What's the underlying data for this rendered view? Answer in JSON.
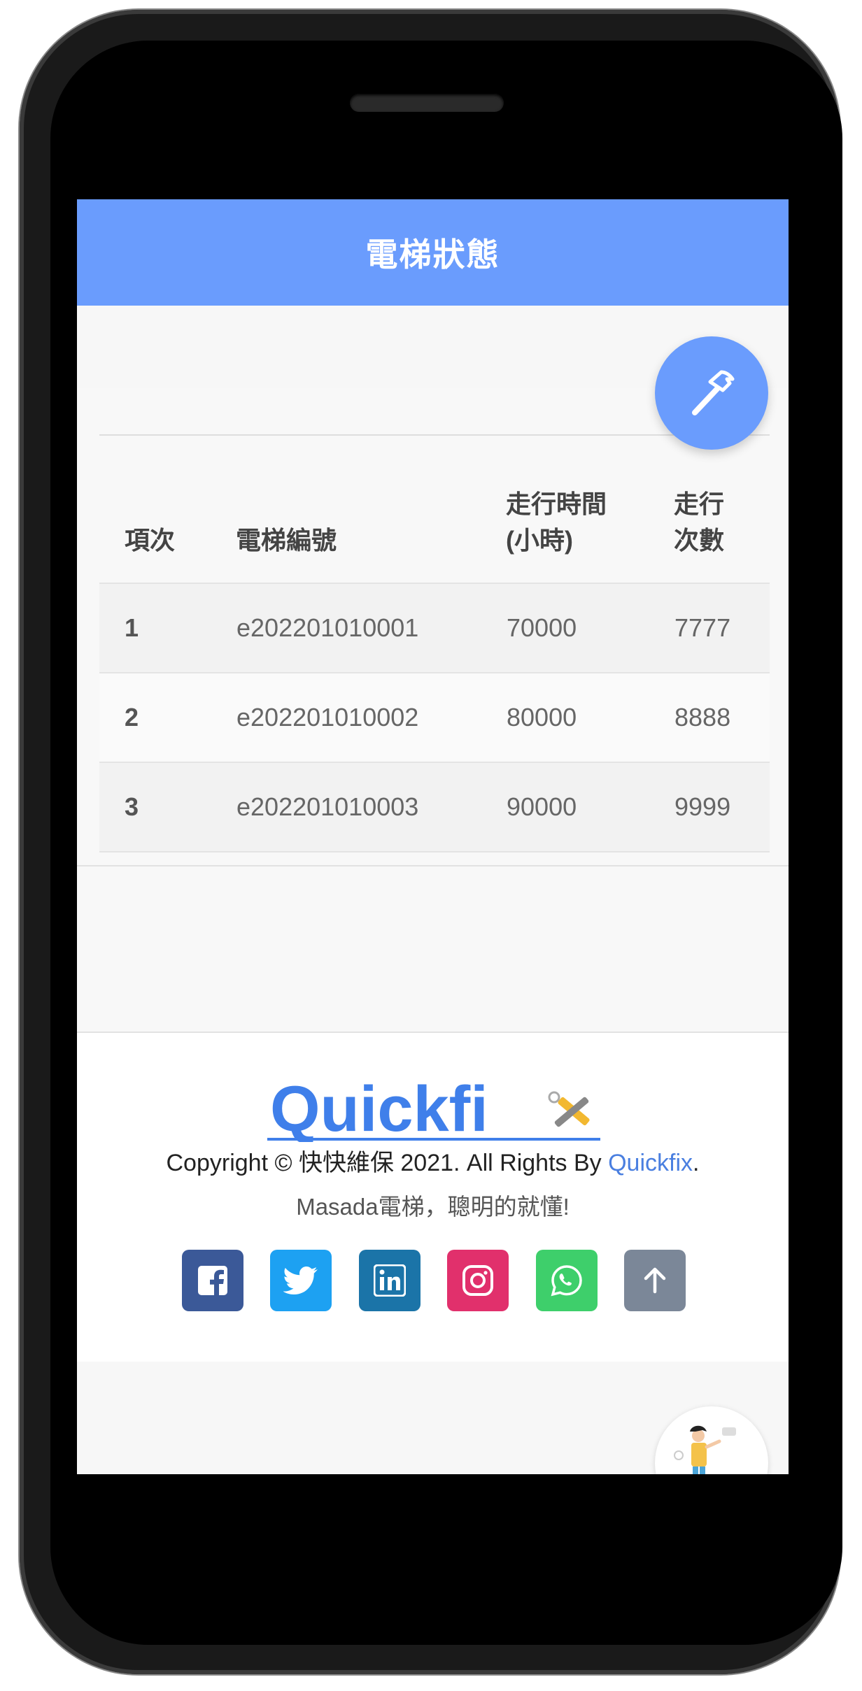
{
  "header": {
    "title": "電梯狀態"
  },
  "table": {
    "headers": [
      {
        "line1": "",
        "line2": "項次"
      },
      {
        "line1": "",
        "line2": "電梯編號"
      },
      {
        "line1": "走行時間",
        "line2": "(小時)"
      },
      {
        "line1": "走行",
        "line2": "次數"
      }
    ],
    "rows": [
      {
        "index": "1",
        "elevator_id": "e202201010001",
        "run_hours": "70000",
        "run_count": "7777"
      },
      {
        "index": "2",
        "elevator_id": "e202201010002",
        "run_hours": "80000",
        "run_count": "8888"
      },
      {
        "index": "3",
        "elevator_id": "e202201010003",
        "run_hours": "90000",
        "run_count": "9999"
      }
    ]
  },
  "footer": {
    "logo_text": "Quickfi",
    "copyright_prefix": "Copyright © 快快維保 2021. All Rights By ",
    "copyright_brand": "Quickfix",
    "copyright_suffix": ".",
    "tagline": "Masada電梯，聰明的就懂!",
    "socials": [
      {
        "icon": "facebook-icon",
        "color": "#3b5998"
      },
      {
        "icon": "twitter-icon",
        "color": "#1da1f2"
      },
      {
        "icon": "linkedin-icon",
        "color": "#1b74a8"
      },
      {
        "icon": "instagram-icon",
        "color": "#e1306c"
      },
      {
        "icon": "whatsapp-icon",
        "color": "#3ecf6b"
      },
      {
        "icon": "arrow-up-icon",
        "color": "#7b8798"
      }
    ]
  },
  "colors": {
    "primary": "#6a9cfd",
    "brand_link": "#4a7fe0"
  }
}
